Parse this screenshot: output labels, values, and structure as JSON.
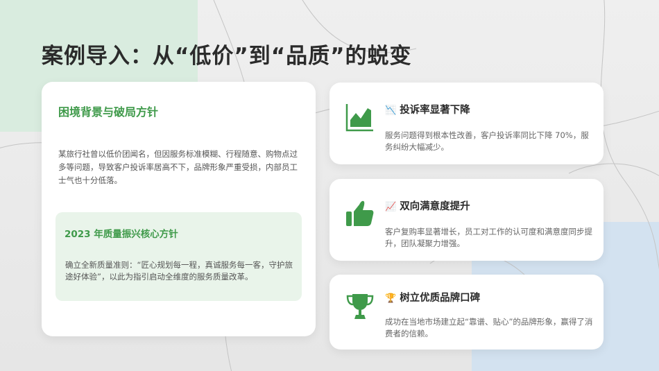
{
  "title": "案例导入：从“低价”到“品质”的蜕变",
  "left": {
    "heading_icon": "",
    "heading": "困境背景与破局方针",
    "body": "某旅行社曾以低价团闻名，但因服务标准模糊、行程随意、购物点过多等问题，导致客户投诉率居高不下，品牌形象严重受损，内部员工士气也十分低落。",
    "policy": {
      "heading_icon": "",
      "heading": "2023 年质量振兴核心方针",
      "body": "确立全新质量准则：“匠心规划每一程，真诚服务每一客，守护旅途好体验”，以此为指引启动全维度的服务质量改革。"
    }
  },
  "cards": [
    {
      "icon": "area-chart-icon",
      "glyph": "📉",
      "heading": "投诉率显著下降",
      "body": "服务问题得到根本性改善，客户投诉率同比下降 70%，服务纠纷大幅减少。"
    },
    {
      "icon": "thumbs-up-icon",
      "glyph": "📈",
      "heading": "双向满意度提升",
      "body": "客户复购率显著增长，员工对工作的认可度和满意度同步提升，团队凝聚力增强。"
    },
    {
      "icon": "trophy-icon",
      "glyph": "🏆",
      "heading": "树立优质品牌口碑",
      "body": "成功在当地市场建立起“靠谱、贴心”的品牌形象，赢得了消费者的信赖。"
    }
  ],
  "colors": {
    "accent_green": "#3f9a4a",
    "title_text": "#2b2b2b",
    "body_text": "#555555",
    "card_bg": "#ffffff",
    "policy_bg": "#e9f4ea"
  }
}
